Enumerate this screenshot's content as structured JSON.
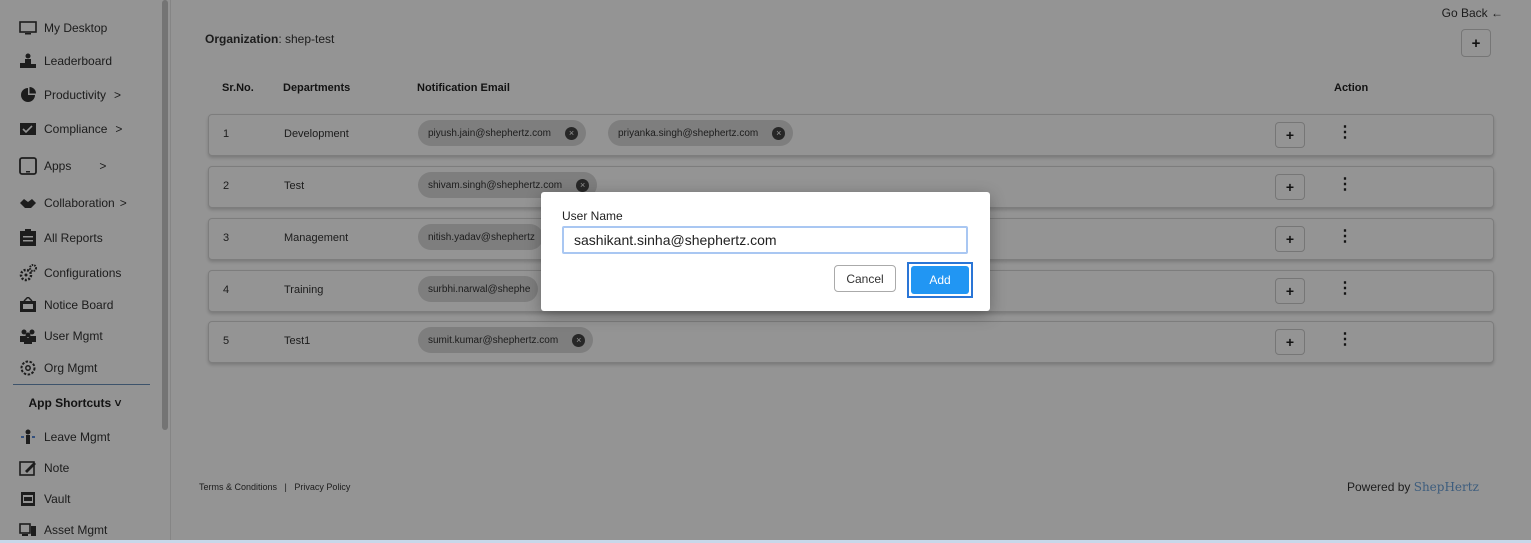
{
  "sidebar": {
    "items": [
      {
        "label": "My Desktop",
        "icon": "monitor-icon",
        "chevron": ""
      },
      {
        "label": "Leaderboard",
        "icon": "podium-icon",
        "chevron": ""
      },
      {
        "label": "Productivity",
        "icon": "pie-chart-icon",
        "chevron": ">"
      },
      {
        "label": "Compliance",
        "icon": "compliance-icon",
        "chevron": ">"
      },
      {
        "label": "Apps",
        "icon": "tablet-icon",
        "chevron": ">"
      },
      {
        "label": "Collaboration",
        "icon": "handshake-icon",
        "chevron": ">"
      },
      {
        "label": "All Reports",
        "icon": "report-icon",
        "chevron": ""
      },
      {
        "label": "Configurations",
        "icon": "gears-icon",
        "chevron": ""
      },
      {
        "label": "Notice Board",
        "icon": "notice-board-icon",
        "chevron": ""
      },
      {
        "label": "User Mgmt",
        "icon": "users-icon",
        "chevron": ""
      },
      {
        "label": "Org Mgmt",
        "icon": "org-gear-icon",
        "chevron": ""
      }
    ],
    "section_title": "App Shortcuts",
    "section_chevron": "˅",
    "shortcuts": [
      {
        "label": "Leave Mgmt",
        "icon": "leave-icon"
      },
      {
        "label": "Note",
        "icon": "note-icon"
      },
      {
        "label": "Vault",
        "icon": "vault-icon"
      },
      {
        "label": "Asset Mgmt",
        "icon": "asset-icon"
      }
    ]
  },
  "header": {
    "go_back": "Go Back",
    "go_back_arrow": "←",
    "org_label": "Organization",
    "org_value": ": shep-test",
    "add_symbol": "+"
  },
  "table": {
    "columns": {
      "sr": "Sr.No.",
      "dept": "Departments",
      "email": "Notification Email",
      "action": "Action"
    },
    "rows": [
      {
        "sr": "1",
        "dept": "Development",
        "emails": [
          "piyush.jain@shephertz.com",
          "priyanka.singh@shephertz.com"
        ]
      },
      {
        "sr": "2",
        "dept": "Test",
        "emails": [
          "shivam.singh@shephertz.com"
        ]
      },
      {
        "sr": "3",
        "dept": "Management",
        "emails": [
          "nitish.yadav@shephertz"
        ]
      },
      {
        "sr": "4",
        "dept": "Training",
        "emails": [
          "surbhi.narwal@shephe"
        ]
      },
      {
        "sr": "5",
        "dept": "Test1",
        "emails": [
          "sumit.kumar@shephertz.com"
        ]
      }
    ],
    "row_add": "+",
    "kebab": "⋮",
    "chip_remove": "×"
  },
  "footer": {
    "terms": "Terms & Conditions",
    "sep": "|",
    "privacy": "Privacy Policy",
    "powered": "Powered by",
    "brand": "ShepHertz"
  },
  "modal": {
    "label": "User Name",
    "value": "sashikant.sinha@shephertz.com",
    "cancel": "Cancel",
    "add": "Add"
  },
  "colors": {
    "primary": "#2196f3",
    "focus_ring": "#2a75d6",
    "overlay": "rgba(0,0,0,0.42)",
    "brand": "#6aa0d8"
  }
}
